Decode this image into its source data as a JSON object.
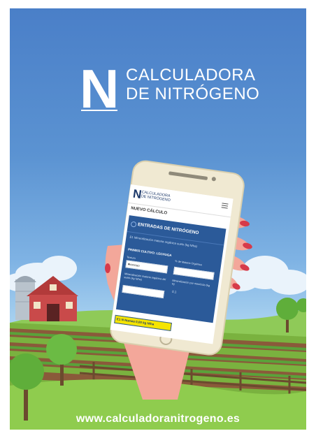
{
  "poster": {
    "logo_letter": "N",
    "logo_line1": "CALCULADORA",
    "logo_line2": "DE NITRÓGENO",
    "website": "www.calculadoranitrogeno.es"
  },
  "phone_screen": {
    "logo_letter": "N",
    "logo_line1": "CALCULADORA",
    "logo_line2": "DE NITRÓGENO",
    "section_title": "NUEVO CÁLCULO",
    "panel_title": "ENTRADAS DE NITRÓGENO",
    "row1_label": "E1  Mineralización materia orgánica suelo (kg N/ha)",
    "crop_label": "PRIMER CULTIVO: LECHUGA",
    "texture_label": "Textura",
    "texture_value": "Arenoso",
    "organic_matter_label": "% de Materia Orgánica",
    "mineralization_label": "Mineralización materia orgánica del suelo (kg N/ha)",
    "mineralization_rate_label": "Mineralización por mes/ciclo (kg N)",
    "mineralization_rate_value": "0,1",
    "result_text": "E1 N Numas 0,00 kg N/ha"
  },
  "colors": {
    "sky_top": "#4a7fc8",
    "panel_blue": "#2b5a99",
    "grass": "#7ec24a",
    "highlight_yellow": "#f5e400"
  }
}
